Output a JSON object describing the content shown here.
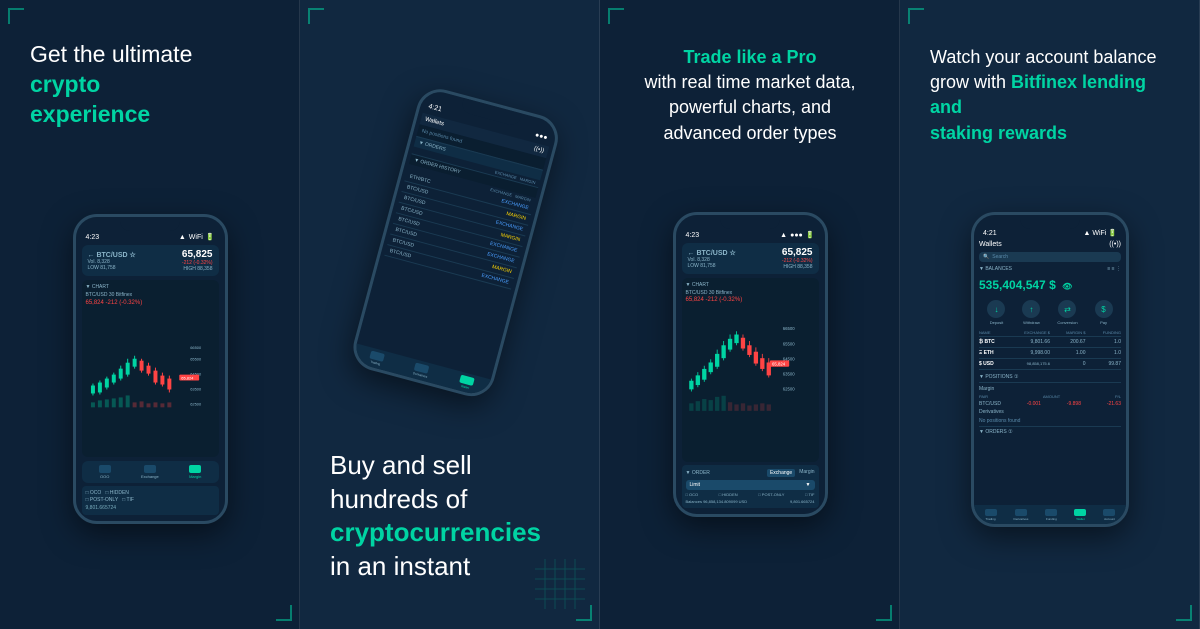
{
  "panel1": {
    "headline_line1": "Get the ultimate",
    "headline_accent1": "crypto",
    "headline_accent2": "experience",
    "phone": {
      "time": "4:23",
      "pair": "BTC/USD 65,825",
      "vol": "Vol. 8,328",
      "low": "81,758",
      "high": "88,358",
      "chart_label": "CHART",
      "indicator_label": "BTC/USD 30 Bitfinex",
      "price_display": "65,824",
      "change": "-212 (-0.32%)",
      "bottom_tabs": [
        "OOO",
        "Exchange",
        "Margin"
      ]
    }
  },
  "panel2": {
    "headline_line1": "Buy and sell",
    "headline_line2": "hundreds of",
    "headline_accent": "cryptocurrencies",
    "headline_line3": "in an instant",
    "phone": {
      "time": "4:21",
      "title": "Wallets",
      "orders_title": "ORDER HISTORY",
      "orders": [
        {
          "pair": "ETH/BTC",
          "type": "EXCHANGE"
        },
        {
          "pair": "BTC/USD",
          "type": "MARGIN"
        },
        {
          "pair": "BTC/USD",
          "type": "EXCHANGE"
        },
        {
          "pair": "BTC/USD",
          "type": "MARGIN"
        },
        {
          "pair": "BTC/USD",
          "type": "EXCHANGE"
        },
        {
          "pair": "BTC/USD",
          "type": "EXCHANGE"
        },
        {
          "pair": "BTC/USD",
          "type": "MARGIN"
        },
        {
          "pair": "BTC/USD",
          "type": "EXCHANGE"
        }
      ]
    }
  },
  "panel3": {
    "headline_accent": "Trade like a Pro",
    "headline_line1": "with real time market data,",
    "headline_line2": "powerful charts, and",
    "headline_line3": "advanced order types",
    "phone": {
      "time": "4:23",
      "pair": "BTC/USD 65,825",
      "chart_label": "CHART",
      "btc_price": "65,825",
      "change": "-212 (-0.32%)",
      "order_section": "ORDER",
      "order_type": "Limit",
      "balances": "96,858,134.809099 USD",
      "amount_btc": "9,801.665724"
    }
  },
  "panel4": {
    "headline_line1": "Watch your account balance",
    "headline_line2": "grow with",
    "headline_accent": "Bitfinex lending and",
    "headline_accent2": "staking rewards",
    "phone": {
      "time": "4:21",
      "title": "Wallets",
      "search_placeholder": "Search",
      "balances_label": "BALANCES",
      "balance_amount": "535,404,547 $",
      "actions": [
        "Deposit",
        "Withdraw",
        "Conversion",
        "Pay"
      ],
      "coins": [
        {
          "coin": "BTC",
          "exchange": "9,801.66",
          "margin": "200.67",
          "funding": "1.0"
        },
        {
          "coin": "ETH",
          "exchange": "9,998.00",
          "margin": "1.00",
          "funding": "1.0"
        },
        {
          "coin": "USD",
          "exchange": "98,858,175.6",
          "margin": "0",
          "funding": "99.87"
        }
      ],
      "positions_label": "POSITIONS",
      "positions_sub": "Margin",
      "positions": [
        {
          "pair": "BTC/USD",
          "amount": "-0.001",
          "pl": "-9.898",
          "pl2": "-21.63"
        }
      ],
      "orders_label": "ORDERS",
      "bottom_tabs": [
        "Trading",
        "Derivatives",
        "Funding",
        "Wallet",
        "Account"
      ]
    }
  }
}
